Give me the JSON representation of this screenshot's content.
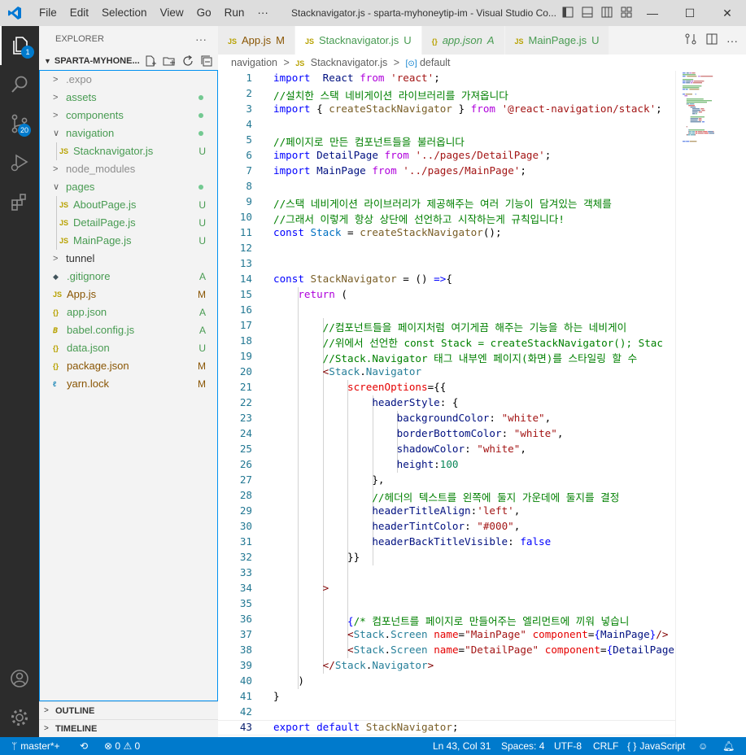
{
  "window": {
    "title": "Stacknavigator.js - sparta-myhoneytip-im - Visual Studio Co...",
    "menu": [
      "File",
      "Edit",
      "Selection",
      "View",
      "Go",
      "Run",
      "···"
    ],
    "controls": {
      "minimize": "—",
      "maximize": "☐",
      "close": "✕"
    }
  },
  "activity": {
    "explorer_badge": "1",
    "scm_badge": "20"
  },
  "sidebar": {
    "header": "EXPLORER",
    "more": "···",
    "project": "SPARTA-MYHONE...",
    "items": [
      {
        "label": ".expo",
        "type": "folder",
        "depth": 0,
        "open": false,
        "status": "",
        "color": "#8e8e8e"
      },
      {
        "label": "assets",
        "type": "folder",
        "depth": 0,
        "open": false,
        "status": "dot",
        "color": "#489b52"
      },
      {
        "label": "components",
        "type": "folder",
        "depth": 0,
        "open": false,
        "status": "dot",
        "color": "#489b52"
      },
      {
        "label": "navigation",
        "type": "folder",
        "depth": 0,
        "open": true,
        "status": "dot",
        "color": "#489b52"
      },
      {
        "label": "Stacknavigator.js",
        "type": "js",
        "depth": 1,
        "status": "U",
        "color": "#489b52"
      },
      {
        "label": "node_modules",
        "type": "folder",
        "depth": 0,
        "open": false,
        "status": "",
        "color": "#8e8e8e"
      },
      {
        "label": "pages",
        "type": "folder",
        "depth": 0,
        "open": true,
        "status": "dot",
        "color": "#489b52"
      },
      {
        "label": "AboutPage.js",
        "type": "js",
        "depth": 1,
        "status": "U",
        "color": "#489b52"
      },
      {
        "label": "DetailPage.js",
        "type": "js",
        "depth": 1,
        "status": "U",
        "color": "#489b52"
      },
      {
        "label": "MainPage.js",
        "type": "js",
        "depth": 1,
        "status": "U",
        "color": "#489b52"
      },
      {
        "label": "tunnel",
        "type": "folder",
        "depth": 0,
        "open": false,
        "status": "",
        "color": "#333333"
      },
      {
        "label": ".gitignore",
        "type": "git",
        "depth": 0,
        "status": "A",
        "color": "#489b52"
      },
      {
        "label": "App.js",
        "type": "js",
        "depth": 0,
        "status": "M",
        "color": "#895503"
      },
      {
        "label": "app.json",
        "type": "json",
        "depth": 0,
        "status": "A",
        "color": "#489b52"
      },
      {
        "label": "babel.config.js",
        "type": "babel",
        "depth": 0,
        "status": "A",
        "color": "#489b52"
      },
      {
        "label": "data.json",
        "type": "json",
        "depth": 0,
        "status": "U",
        "color": "#489b52"
      },
      {
        "label": "package.json",
        "type": "json",
        "depth": 0,
        "status": "M",
        "color": "#895503"
      },
      {
        "label": "yarn.lock",
        "type": "yarn",
        "depth": 0,
        "status": "M",
        "color": "#895503"
      }
    ],
    "outline": "OUTLINE",
    "timeline": "TIMELINE"
  },
  "tabs": [
    {
      "label": "App.js",
      "icon": "JS",
      "status": "M",
      "active": false,
      "italic": false,
      "status_color": "#895503"
    },
    {
      "label": "Stacknavigator.js",
      "icon": "JS",
      "status": "U",
      "active": true,
      "italic": false,
      "status_color": "#489b52"
    },
    {
      "label": "app.json",
      "icon": "{}",
      "status": "A",
      "active": false,
      "italic": true,
      "status_color": "#489b52"
    },
    {
      "label": "MainPage.js",
      "icon": "JS",
      "status": "U",
      "active": false,
      "italic": false,
      "status_color": "#489b52"
    }
  ],
  "breadcrumb": {
    "folder": "navigation",
    "file": "Stacknavigator.js",
    "symbol": "default",
    "sep": ">"
  },
  "code": [
    {
      "n": "1",
      "t": [
        [
          "kw",
          "import"
        ],
        [
          "",
          "  "
        ],
        [
          "vr",
          "React"
        ],
        [
          "",
          " "
        ],
        [
          "ctl",
          "from"
        ],
        [
          "",
          " "
        ],
        [
          "str",
          "'react'"
        ],
        [
          "",
          ";"
        ]
      ]
    },
    {
      "n": "2",
      "t": [
        [
          "cm",
          "//설치한 스택 네비게이션 라이브러리를 가져옵니다"
        ]
      ]
    },
    {
      "n": "3",
      "t": [
        [
          "kw",
          "import"
        ],
        [
          "",
          " { "
        ],
        [
          "fn",
          "createStackNavigator"
        ],
        [
          "",
          " } "
        ],
        [
          "ctl",
          "from"
        ],
        [
          "",
          " "
        ],
        [
          "str",
          "'@react-navigation/stack'"
        ],
        [
          "",
          ";"
        ]
      ]
    },
    {
      "n": "4",
      "t": []
    },
    {
      "n": "5",
      "t": [
        [
          "cm",
          "//페이지로 만든 컴포넌트들을 불러옵니다"
        ]
      ]
    },
    {
      "n": "6",
      "t": [
        [
          "kw",
          "import"
        ],
        [
          "",
          " "
        ],
        [
          "vr",
          "DetailPage"
        ],
        [
          "",
          " "
        ],
        [
          "ctl",
          "from"
        ],
        [
          "",
          " "
        ],
        [
          "str",
          "'../pages/DetailPage'"
        ],
        [
          "",
          ";"
        ]
      ]
    },
    {
      "n": "7",
      "t": [
        [
          "kw",
          "import"
        ],
        [
          "",
          " "
        ],
        [
          "vr",
          "MainPage"
        ],
        [
          "",
          " "
        ],
        [
          "ctl",
          "from"
        ],
        [
          "",
          " "
        ],
        [
          "str",
          "'../pages/MainPage'"
        ],
        [
          "",
          ";"
        ]
      ]
    },
    {
      "n": "8",
      "t": []
    },
    {
      "n": "9",
      "t": [
        [
          "cm",
          "//스택 네비게이션 라이브러리가 제공해주는 여러 기능이 담겨있는 객체를"
        ]
      ]
    },
    {
      "n": "10",
      "t": [
        [
          "cm",
          "//그래서 이렇게 항상 상단에 선언하고 시작하는게 규칙입니다!"
        ]
      ]
    },
    {
      "n": "11",
      "t": [
        [
          "kw",
          "const"
        ],
        [
          "",
          " "
        ],
        [
          "cl",
          "Stack"
        ],
        [
          "",
          " = "
        ],
        [
          "fn",
          "createStackNavigator"
        ],
        [
          "",
          "();"
        ]
      ]
    },
    {
      "n": "12",
      "t": []
    },
    {
      "n": "13",
      "t": []
    },
    {
      "n": "14",
      "t": [
        [
          "kw",
          "const"
        ],
        [
          "",
          " "
        ],
        [
          "fn",
          "StackNavigator"
        ],
        [
          "",
          " = () "
        ],
        [
          "kw",
          "=>"
        ],
        [
          "",
          "{"
        ]
      ]
    },
    {
      "n": "15",
      "t": [
        [
          "",
          "    "
        ],
        [
          "ctl",
          "return"
        ],
        [
          "",
          " ("
        ]
      ]
    },
    {
      "n": "16",
      "t": []
    },
    {
      "n": "17",
      "t": [
        [
          "",
          "        "
        ],
        [
          "cm",
          "//컴포넌트들을 페이지처럼 여기게끔 해주는 기능을 하는 네비게이"
        ]
      ]
    },
    {
      "n": "18",
      "t": [
        [
          "",
          "        "
        ],
        [
          "cm",
          "//위에서 선언한 const Stack = createStackNavigator(); Stac"
        ]
      ]
    },
    {
      "n": "19",
      "t": [
        [
          "",
          "        "
        ],
        [
          "cm",
          "//Stack.Navigator 태그 내부엔 페이지(화면)를 스타일링 할 수"
        ]
      ]
    },
    {
      "n": "20",
      "t": [
        [
          "",
          "        "
        ],
        [
          "tg",
          "<"
        ],
        [
          "ty",
          "Stack"
        ],
        [
          "",
          "."
        ],
        [
          "ty",
          "Navigator"
        ]
      ]
    },
    {
      "n": "21",
      "t": [
        [
          "",
          "            "
        ],
        [
          "at",
          "screenOptions"
        ],
        [
          "",
          "={{"
        ]
      ]
    },
    {
      "n": "22",
      "t": [
        [
          "",
          "                "
        ],
        [
          "vr",
          "headerStyle"
        ],
        [
          "",
          ": {"
        ]
      ]
    },
    {
      "n": "23",
      "t": [
        [
          "",
          "                    "
        ],
        [
          "vr",
          "backgroundColor"
        ],
        [
          "",
          ": "
        ],
        [
          "str",
          "\"white\""
        ],
        [
          "",
          ","
        ]
      ]
    },
    {
      "n": "24",
      "t": [
        [
          "",
          "                    "
        ],
        [
          "vr",
          "borderBottomColor"
        ],
        [
          "",
          ": "
        ],
        [
          "str",
          "\"white\""
        ],
        [
          "",
          ","
        ]
      ]
    },
    {
      "n": "25",
      "t": [
        [
          "",
          "                    "
        ],
        [
          "vr",
          "shadowColor"
        ],
        [
          "",
          ": "
        ],
        [
          "str",
          "\"white\""
        ],
        [
          "",
          ","
        ]
      ]
    },
    {
      "n": "26",
      "t": [
        [
          "",
          "                    "
        ],
        [
          "vr",
          "height"
        ],
        [
          "",
          ":"
        ],
        [
          "nm",
          "100"
        ]
      ]
    },
    {
      "n": "27",
      "t": [
        [
          "",
          "                },"
        ]
      ]
    },
    {
      "n": "28",
      "t": [
        [
          "",
          "                "
        ],
        [
          "cm",
          "//헤더의 텍스트를 왼쪽에 둘지 가운데에 둘지를 결정"
        ]
      ]
    },
    {
      "n": "29",
      "t": [
        [
          "",
          "                "
        ],
        [
          "vr",
          "headerTitleAlign"
        ],
        [
          "",
          ":"
        ],
        [
          "str",
          "'left'"
        ],
        [
          "",
          ","
        ]
      ]
    },
    {
      "n": "30",
      "t": [
        [
          "",
          "                "
        ],
        [
          "vr",
          "headerTintColor"
        ],
        [
          "",
          ": "
        ],
        [
          "str",
          "\"#000\""
        ],
        [
          "",
          ","
        ]
      ]
    },
    {
      "n": "31",
      "t": [
        [
          "",
          "                "
        ],
        [
          "vr",
          "headerBackTitleVisible"
        ],
        [
          "",
          ": "
        ],
        [
          "kw",
          "false"
        ]
      ]
    },
    {
      "n": "32",
      "t": [
        [
          "",
          "            }}"
        ]
      ]
    },
    {
      "n": "33",
      "t": []
    },
    {
      "n": "34",
      "t": [
        [
          "",
          "        "
        ],
        [
          "tg",
          ">"
        ]
      ]
    },
    {
      "n": "35",
      "t": []
    },
    {
      "n": "36",
      "t": [
        [
          "",
          "            "
        ],
        [
          "kw",
          "{"
        ],
        [
          "cm",
          "/* 컴포넌트를 페이지로 만들어주는 엘리먼트에 끼워 넣습니"
        ]
      ]
    },
    {
      "n": "37",
      "t": [
        [
          "",
          "            "
        ],
        [
          "tg",
          "<"
        ],
        [
          "ty",
          "Stack"
        ],
        [
          "",
          "."
        ],
        [
          "ty",
          "Screen"
        ],
        [
          "",
          " "
        ],
        [
          "at",
          "name"
        ],
        [
          "",
          "="
        ],
        [
          "str",
          "\"MainPage\""
        ],
        [
          "",
          " "
        ],
        [
          "at",
          "component"
        ],
        [
          "",
          "="
        ],
        [
          "kw",
          "{"
        ],
        [
          "vr",
          "MainPage"
        ],
        [
          "kw",
          "}"
        ],
        [
          "tg",
          "/>"
        ]
      ]
    },
    {
      "n": "38",
      "t": [
        [
          "",
          "            "
        ],
        [
          "tg",
          "<"
        ],
        [
          "ty",
          "Stack"
        ],
        [
          "",
          "."
        ],
        [
          "ty",
          "Screen"
        ],
        [
          "",
          " "
        ],
        [
          "at",
          "name"
        ],
        [
          "",
          "="
        ],
        [
          "str",
          "\"DetailPage\""
        ],
        [
          "",
          " "
        ],
        [
          "at",
          "component"
        ],
        [
          "",
          "="
        ],
        [
          "kw",
          "{"
        ],
        [
          "vr",
          "DetailPage"
        ]
      ]
    },
    {
      "n": "39",
      "t": [
        [
          "",
          "        "
        ],
        [
          "tg",
          "</"
        ],
        [
          "ty",
          "Stack"
        ],
        [
          "",
          "."
        ],
        [
          "ty",
          "Navigator"
        ],
        [
          "tg",
          ">"
        ]
      ]
    },
    {
      "n": "40",
      "t": [
        [
          "",
          "    )"
        ]
      ]
    },
    {
      "n": "41",
      "t": [
        [
          "",
          "}"
        ]
      ]
    },
    {
      "n": "42",
      "t": []
    },
    {
      "n": "43",
      "t": [
        [
          "kw",
          "export"
        ],
        [
          "",
          " "
        ],
        [
          "kw",
          "default"
        ],
        [
          "",
          " "
        ],
        [
          "fn",
          "StackNavigator"
        ],
        [
          "",
          ";"
        ]
      ]
    }
  ],
  "current_line": 43,
  "status": {
    "branch": "master*+",
    "errors": "0",
    "warnings": "0",
    "position": "Ln 43, Col 31",
    "spaces": "Spaces: 4",
    "encoding": "UTF-8",
    "eol": "CRLF",
    "language": "JavaScript",
    "lang_icon": "{ }"
  },
  "colors": {
    "accent": "#007acc",
    "activity": "#2c2c2c",
    "sidebar": "#f3f3f3"
  }
}
